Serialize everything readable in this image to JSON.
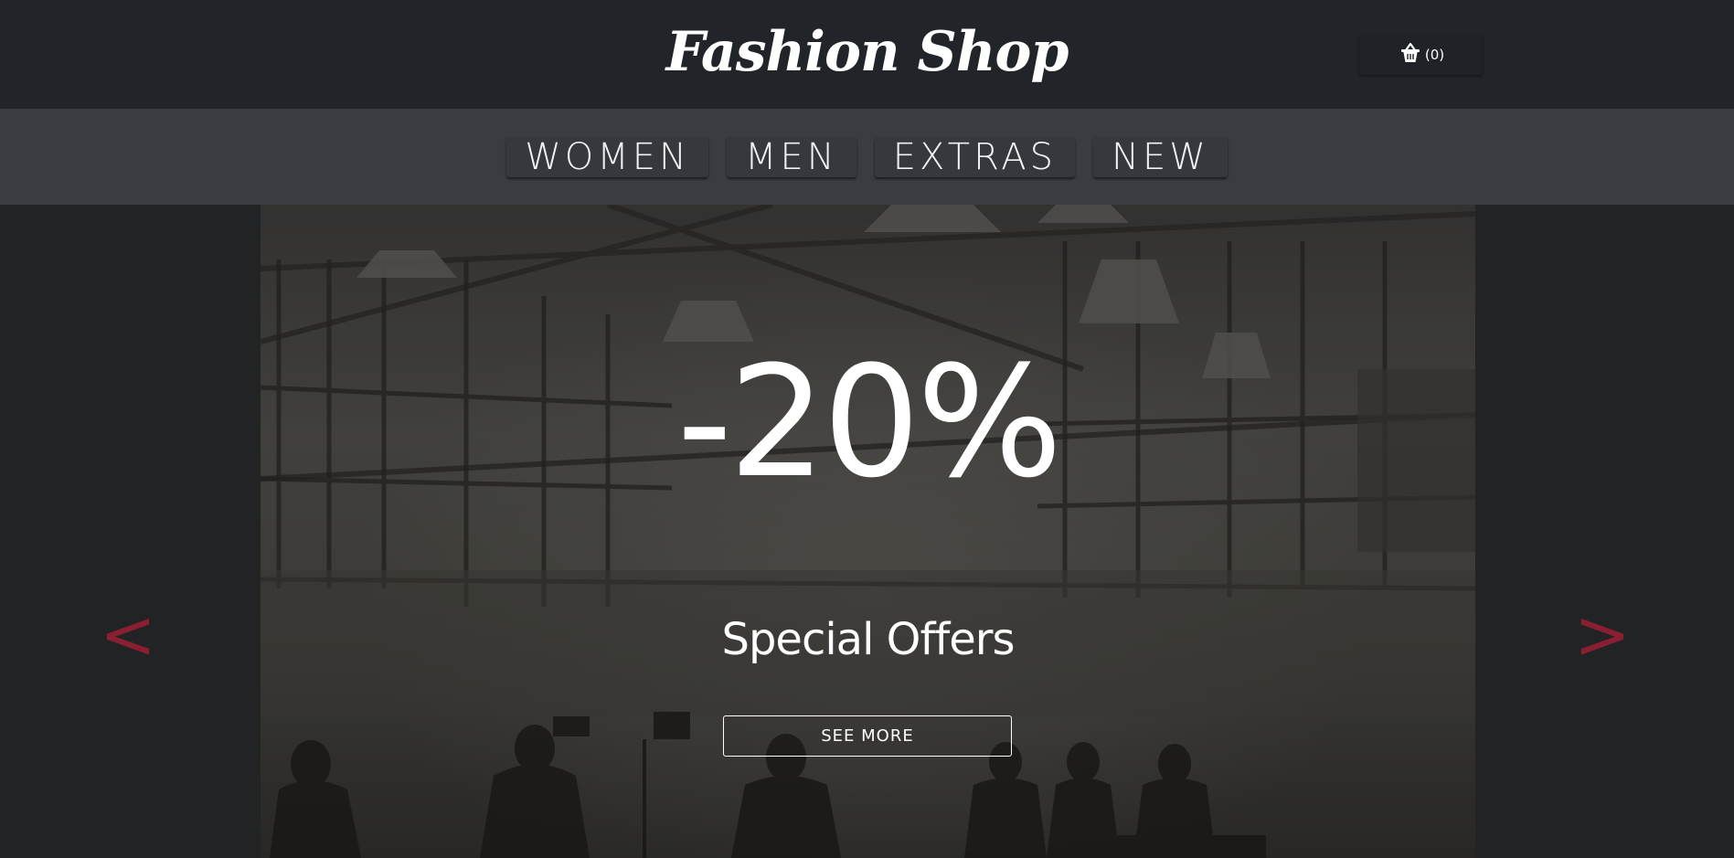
{
  "header": {
    "brand": "Fashion Shop",
    "cart": {
      "icon": "basket-icon",
      "count_label": "(0)"
    }
  },
  "nav": {
    "items": [
      {
        "label": "WOMEN"
      },
      {
        "label": "MEN"
      },
      {
        "label": "EXTRAS"
      },
      {
        "label": "NEW"
      }
    ]
  },
  "hero": {
    "headline": "-20%",
    "title": "Special Offers",
    "button_label": "SEE MORE",
    "prev_label": "<",
    "next_label": ">"
  },
  "colors": {
    "header_bg": "#212429",
    "nav_bg": "#393c41",
    "page_bg": "#222324",
    "arrow": "#8b1f32",
    "text": "#ffffff"
  }
}
